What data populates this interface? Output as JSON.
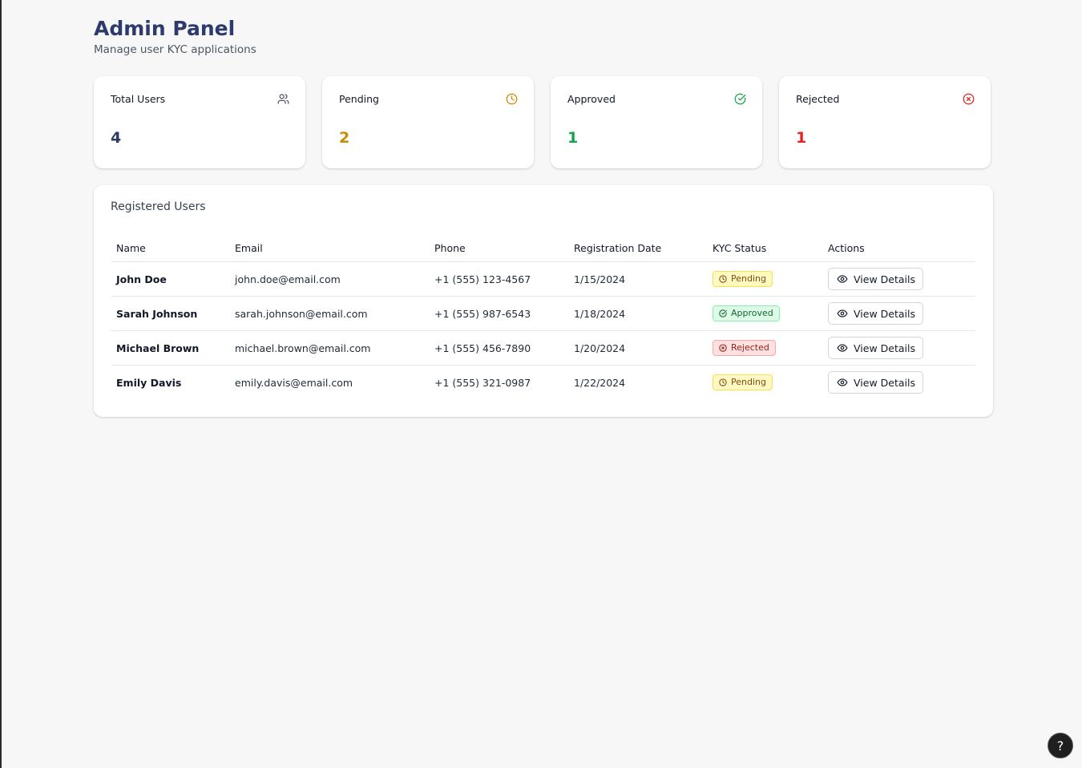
{
  "header": {
    "title": "Admin Panel",
    "subtitle": "Manage user KYC applications"
  },
  "stats": [
    {
      "label": "Total Users",
      "value": "4",
      "icon": "users-icon",
      "color": "#2d3a6b",
      "icon_color": "#4b5563"
    },
    {
      "label": "Pending",
      "value": "2",
      "icon": "clock-icon",
      "color": "#ca8a04",
      "icon_color": "#ca8a04"
    },
    {
      "label": "Approved",
      "value": "1",
      "icon": "check-circle-icon",
      "color": "#16a34a",
      "icon_color": "#16a34a"
    },
    {
      "label": "Rejected",
      "value": "1",
      "icon": "x-circle-icon",
      "color": "#dc2626",
      "icon_color": "#dc2626"
    }
  ],
  "users_table": {
    "title": "Registered Users",
    "columns": [
      "Name",
      "Email",
      "Phone",
      "Registration Date",
      "KYC Status",
      "Actions"
    ],
    "rows": [
      {
        "name": "John Doe",
        "email": "john.doe@email.com",
        "phone": "+1 (555) 123-4567",
        "date": "1/15/2024",
        "status": "Pending",
        "action": "View Details"
      },
      {
        "name": "Sarah Johnson",
        "email": "sarah.johnson@email.com",
        "phone": "+1 (555) 987-6543",
        "date": "1/18/2024",
        "status": "Approved",
        "action": "View Details"
      },
      {
        "name": "Michael Brown",
        "email": "michael.brown@email.com",
        "phone": "+1 (555) 456-7890",
        "date": "1/20/2024",
        "status": "Rejected",
        "action": "View Details"
      },
      {
        "name": "Emily Davis",
        "email": "emily.davis@email.com",
        "phone": "+1 (555) 321-0987",
        "date": "1/22/2024",
        "status": "Pending",
        "action": "View Details"
      }
    ]
  },
  "help": {
    "label": "?",
    "icon": "help-icon"
  }
}
